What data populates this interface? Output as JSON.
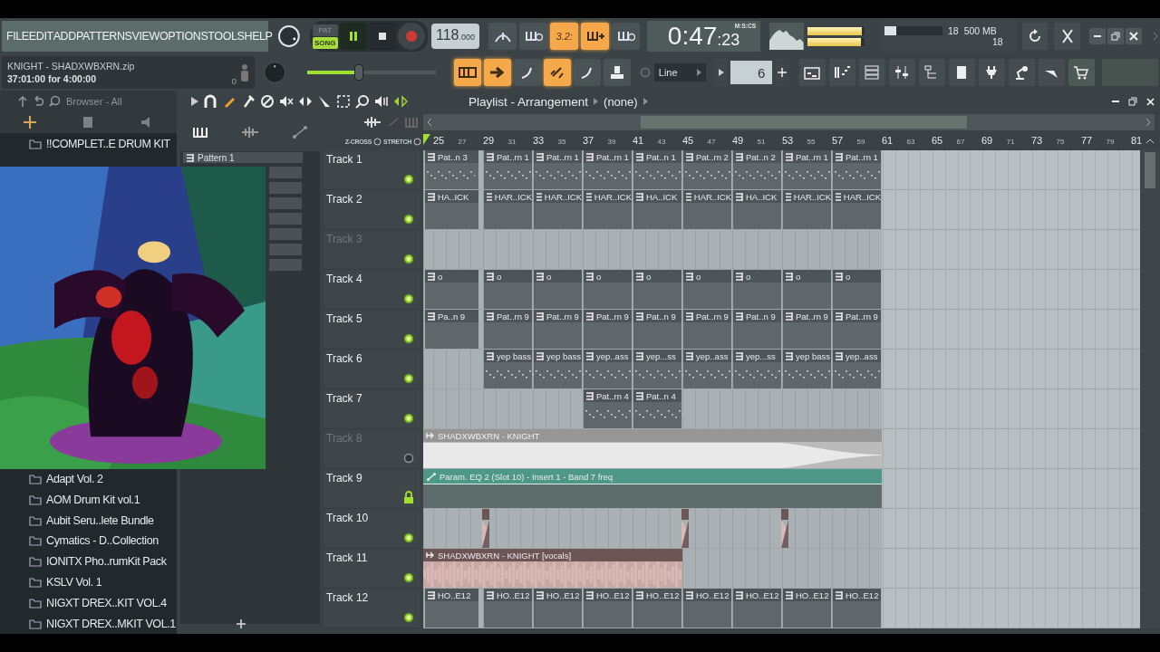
{
  "menu": [
    "FILE",
    "EDIT",
    "ADD",
    "PATTERNS",
    "VIEW",
    "OPTIONS",
    "TOOLS",
    "HELP"
  ],
  "project": {
    "title": "KNIGHT - SHADXWBXRN.zip",
    "position": "37:01:00 for 4:00:00",
    "hint": "o"
  },
  "transport": {
    "modes": [
      {
        "label": "PAT",
        "selected": false
      },
      {
        "label": "SONG",
        "selected": true
      }
    ],
    "playing": true,
    "recording": false,
    "tempo_whole": "118",
    "tempo_fraction": ".000"
  },
  "toggles": [
    {
      "on": false
    },
    {
      "on": false
    },
    {
      "on": true,
      "label": "3.2:"
    },
    {
      "on": true
    },
    {
      "on": false
    }
  ],
  "time": {
    "main": "0:47",
    "centis": ":23",
    "format": "M:S:CS"
  },
  "meters": [
    {
      "level": 0.95
    },
    {
      "level": 0.93
    }
  ],
  "memory": {
    "level": 0.2,
    "polyphony": "18",
    "ram": "500 MB",
    "cpu": "18"
  },
  "master_volume": {
    "level": 0.4
  },
  "tools": [
    {
      "on": true
    },
    {
      "on": true
    },
    {
      "on": false
    },
    {
      "on": true
    },
    {
      "on": false
    }
  ],
  "snap": {
    "value": "Line"
  },
  "step": {
    "value": "6"
  },
  "browser": {
    "title": "Browser - All",
    "folders": [
      "!!COMPLET..E DRUM KIT",
      "Adapt Vol. 2",
      "AOM Drum Kit vol.1",
      "Aubit Seru..lete Bundle",
      "Cymatics - D..Collection",
      "IONITX Pho..rumKit Pack",
      "KSLV Vol. 1",
      "NIGXT DREX..KIT VOL.4",
      "NIGXT DREX..MKIT VOL.1"
    ]
  },
  "picker": {
    "patterns": [
      "Pattern 1"
    ]
  },
  "playlist": {
    "title": "Playlist - Arrangement",
    "pattern": "(none)",
    "zcross": "Z-CROSS",
    "stretch": "STRETCH",
    "ruler": [
      "25",
      "27",
      "29",
      "31",
      "33",
      "35",
      "37",
      "39",
      "41",
      "43",
      "45",
      "47",
      "49",
      "51",
      "53",
      "55",
      "57",
      "59",
      "61",
      "63",
      "65",
      "67",
      "69",
      "71",
      "73",
      "75",
      "77",
      "79",
      "81"
    ],
    "tracks": [
      {
        "name": "Track 1",
        "muted": false,
        "dimmed": false,
        "locked": false,
        "blocks": [
          {
            "kind": "notes",
            "name": "Pat..n 3"
          },
          {
            "kind": "notes",
            "name": "Pat..rn 1"
          },
          {
            "kind": "notes",
            "name": "Pat..rn 1"
          },
          {
            "kind": "notes",
            "name": "Pat..rn 1"
          },
          {
            "kind": "notes",
            "name": "Pat..n 1"
          },
          {
            "kind": "notes",
            "name": "Pat..rn 2"
          },
          {
            "kind": "notes",
            "name": "Pat..n 2"
          },
          {
            "kind": "notes",
            "name": "Pat..rn 1"
          },
          {
            "kind": "notes",
            "name": "Pat..rn 1"
          }
        ]
      },
      {
        "name": "Track 2",
        "muted": false,
        "dimmed": false,
        "locked": false,
        "blocks": [
          {
            "kind": "pattern",
            "name": "HA..ICK"
          },
          {
            "kind": "pattern",
            "name": "HAR..ICK"
          },
          {
            "kind": "pattern",
            "name": "HAR..ICK"
          },
          {
            "kind": "pattern",
            "name": "HAR..ICK"
          },
          {
            "kind": "pattern",
            "name": "HA..ICK"
          },
          {
            "kind": "pattern",
            "name": "HAR..ICK"
          },
          {
            "kind": "pattern",
            "name": "HA..ICK"
          },
          {
            "kind": "pattern",
            "name": "HAR..ICK"
          },
          {
            "kind": "pattern",
            "name": "HAR..ICK"
          }
        ]
      },
      {
        "name": "Track 3",
        "muted": false,
        "dimmed": true,
        "locked": false
      },
      {
        "name": "Track 4",
        "muted": false,
        "dimmed": false,
        "locked": false,
        "blocks": [
          {
            "kind": "pattern",
            "name": "o"
          },
          {
            "kind": "pattern",
            "name": "o"
          },
          {
            "kind": "pattern",
            "name": "o"
          },
          {
            "kind": "pattern",
            "name": "o"
          },
          {
            "kind": "pattern",
            "name": "o"
          },
          {
            "kind": "pattern",
            "name": "o"
          },
          {
            "kind": "pattern",
            "name": "o"
          },
          {
            "kind": "pattern",
            "name": "o"
          },
          {
            "kind": "pattern",
            "name": "o"
          }
        ]
      },
      {
        "name": "Track 5",
        "muted": false,
        "dimmed": false,
        "locked": false,
        "blocks": [
          {
            "kind": "pattern",
            "name": "Pa..n 9"
          },
          {
            "kind": "pattern",
            "name": "Pat..rn 9"
          },
          {
            "kind": "pattern",
            "name": "Pat..rn 9"
          },
          {
            "kind": "pattern",
            "name": "Pat..rn 9"
          },
          {
            "kind": "pattern",
            "name": "Pat..n 9"
          },
          {
            "kind": "pattern",
            "name": "Pat..rn 9"
          },
          {
            "kind": "pattern",
            "name": "Pat..n 9"
          },
          {
            "kind": "pattern",
            "name": "Pat..rn 9"
          },
          {
            "kind": "pattern",
            "name": "Pat..rn 9"
          }
        ]
      },
      {
        "name": "Track 6",
        "muted": false,
        "dimmed": false,
        "locked": false,
        "blocks": [
          {
            "kind": "empty"
          },
          {
            "kind": "notes",
            "name": "yep bass"
          },
          {
            "kind": "notes",
            "name": "yep bass"
          },
          {
            "kind": "notes",
            "name": "yep..ass"
          },
          {
            "kind": "notes",
            "name": "yep...ss"
          },
          {
            "kind": "notes",
            "name": "yep..ass"
          },
          {
            "kind": "notes",
            "name": "yep...ss"
          },
          {
            "kind": "notes",
            "name": "yep bass"
          },
          {
            "kind": "notes",
            "name": "yep..ass"
          }
        ]
      },
      {
        "name": "Track 7",
        "muted": false,
        "dimmed": false,
        "locked": false,
        "blocks": [
          {
            "kind": "empty"
          },
          {
            "kind": "empty"
          },
          {
            "kind": "empty"
          },
          {
            "kind": "notes",
            "name": "Pat..rn 4"
          },
          {
            "kind": "notes",
            "name": "Pat..n 4"
          }
        ]
      },
      {
        "name": "Track 8",
        "muted": true,
        "dimmed": true,
        "locked": false,
        "blocks": [
          {
            "kind": "audio",
            "name": "SHADXWBXRN - KNIGHT"
          },
          {
            "kind": "continued"
          },
          {
            "kind": "continued"
          },
          {
            "kind": "continued"
          },
          {
            "kind": "continued"
          },
          {
            "kind": "continued"
          },
          {
            "kind": "continued"
          },
          {
            "kind": "continued"
          },
          {
            "kind": "continued"
          }
        ]
      },
      {
        "name": "Track 9",
        "muted": false,
        "dimmed": false,
        "locked": true,
        "blocks": [
          {
            "kind": "automation",
            "name": "Param. EQ 2 (Slot 10) - Insert 1 - Band 7 freq"
          },
          {
            "kind": "continued"
          },
          {
            "kind": "continued"
          },
          {
            "kind": "continued"
          },
          {
            "kind": "continued"
          },
          {
            "kind": "continued"
          },
          {
            "kind": "continued"
          },
          {
            "kind": "continued"
          },
          {
            "kind": "continued"
          }
        ]
      },
      {
        "name": "Track 10",
        "muted": false,
        "dimmed": false,
        "locked": false,
        "blocks": [
          {
            "kind": "empty"
          },
          {
            "kind": "slice"
          },
          {
            "kind": "empty"
          },
          {
            "kind": "empty"
          },
          {
            "kind": "empty"
          },
          {
            "kind": "slice"
          },
          {
            "kind": "empty"
          },
          {
            "kind": "slice"
          }
        ]
      },
      {
        "name": "Track 11",
        "muted": false,
        "dimmed": false,
        "locked": false,
        "blocks": [
          {
            "kind": "audio",
            "name": "SHADXWBXRN - KNIGHT [vocals]"
          },
          {
            "kind": "continued"
          },
          {
            "kind": "continued"
          },
          {
            "kind": "continued"
          },
          {
            "kind": "continued"
          }
        ]
      },
      {
        "name": "Track 12",
        "muted": false,
        "dimmed": false,
        "locked": false,
        "blocks": [
          {
            "kind": "pattern",
            "name": "HO..E12"
          },
          {
            "kind": "pattern",
            "name": "HO..E12"
          },
          {
            "kind": "pattern",
            "name": "HO..E12"
          },
          {
            "kind": "pattern",
            "name": "HO..E12"
          },
          {
            "kind": "pattern",
            "name": "HO..E12"
          },
          {
            "kind": "pattern",
            "name": "HO..E12"
          },
          {
            "kind": "pattern",
            "name": "HO..E12"
          },
          {
            "kind": "pattern",
            "name": "HO..E12"
          },
          {
            "kind": "pattern",
            "name": "HO..E12"
          }
        ]
      }
    ]
  }
}
